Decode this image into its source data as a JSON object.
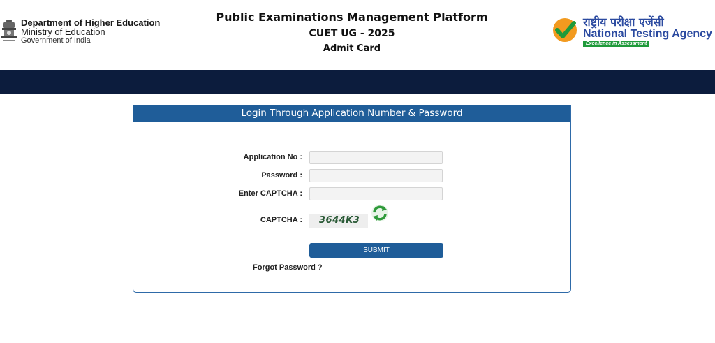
{
  "header": {
    "dhe": {
      "line1": "Department of Higher Education",
      "line2": "Ministry of Education",
      "line3": "Government of India"
    },
    "title": "Public Examinations Management Platform",
    "exam": "CUET UG - 2025",
    "subtitle": "Admit Card",
    "nta": {
      "hindi": "राष्ट्रीय परीक्षा एजेंसी",
      "english": "National Testing Agency",
      "tagline": "Excellence in Assessment"
    }
  },
  "colors": {
    "navbar": "#0c1c3d",
    "panel_header": "#1f5d99",
    "nta_blue": "#2b4aa0",
    "nta_green": "#1f9a3a"
  },
  "login": {
    "heading": "Login Through Application Number & Password",
    "application_label": "Application No :",
    "application_value": "",
    "password_label": "Password :",
    "password_value": "",
    "captcha_input_label": "Enter CAPTCHA :",
    "captcha_input_value": "",
    "captcha_label": "CAPTCHA :",
    "captcha_code": "3644K3",
    "submit_label": "SUBMIT",
    "forgot_label": "Forgot Password ?",
    "refresh_icon": "refresh-icon"
  }
}
